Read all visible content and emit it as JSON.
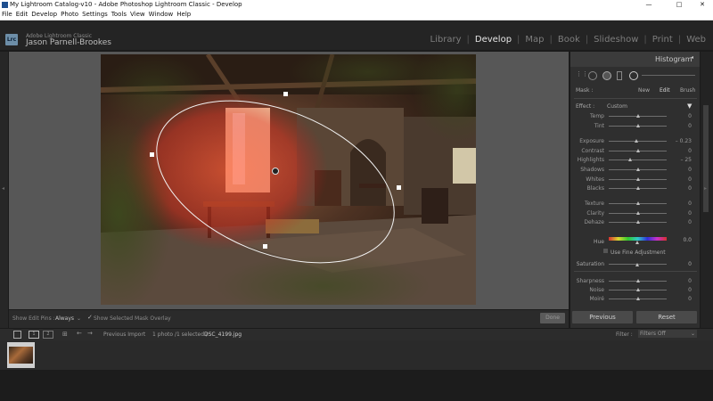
{
  "window": {
    "title": "My Lightroom Catalog-v10 - Adobe Photoshop Lightroom Classic - Develop",
    "min": "—",
    "max": "□",
    "close": "✕"
  },
  "menu": [
    "File",
    "Edit",
    "Develop",
    "Photo",
    "Settings",
    "Tools",
    "View",
    "Window",
    "Help"
  ],
  "identity": {
    "logo": "Lrc",
    "product": "Adobe Lightroom Classic",
    "user": "Jason Parnell-Brookes"
  },
  "modules": [
    "Library",
    "Develop",
    "Map",
    "Book",
    "Slideshow",
    "Print",
    "Web"
  ],
  "active_module": "Develop",
  "right_panel": {
    "histogram_label": "Histogram",
    "mask_label": "Mask :",
    "mask_actions": [
      "New",
      "Edit",
      "Brush"
    ],
    "effect_label": "Effect :",
    "effect_value": "Custom",
    "sliders": [
      {
        "label": "Temp",
        "value": "0",
        "pos": 0.5
      },
      {
        "label": "Tint",
        "value": "0",
        "pos": 0.5
      },
      {
        "label": "Exposure",
        "value": "– 0.23",
        "pos": 0.48
      },
      {
        "label": "Contrast",
        "value": "0",
        "pos": 0.5
      },
      {
        "label": "Highlights",
        "value": "– 25",
        "pos": 0.37
      },
      {
        "label": "Shadows",
        "value": "0",
        "pos": 0.5
      },
      {
        "label": "Whites",
        "value": "0",
        "pos": 0.5
      },
      {
        "label": "Blacks",
        "value": "0",
        "pos": 0.5
      },
      {
        "label": "Texture",
        "value": "0",
        "pos": 0.5
      },
      {
        "label": "Clarity",
        "value": "0",
        "pos": 0.5
      },
      {
        "label": "Dehaze",
        "value": "0",
        "pos": 0.5
      }
    ],
    "hue_label": "Hue",
    "hue_value": "0.0",
    "fine_adjust": "Use Fine Adjustment",
    "saturation_label": "Saturation",
    "saturation_value": "0",
    "sliders2": [
      {
        "label": "Sharpness",
        "value": "0",
        "pos": 0.5
      },
      {
        "label": "Noise",
        "value": "0",
        "pos": 0.5
      },
      {
        "label": "Moiré",
        "value": "0",
        "pos": 0.5
      }
    ],
    "previous_btn": "Previous",
    "reset_btn": "Reset"
  },
  "toolbar": {
    "show_pins_label": "Show Edit Pins :",
    "show_pins_value": "Always",
    "overlay_label": "Show Selected Mask Overlay",
    "done": "Done"
  },
  "filmstrip": {
    "view1": "1",
    "view2": "2",
    "source": "Previous Import",
    "info": "1 photo /1 selected /",
    "filename": "DSC_4199.jpg",
    "filter_label": "Filter :",
    "filter_value": "Filters Off"
  }
}
